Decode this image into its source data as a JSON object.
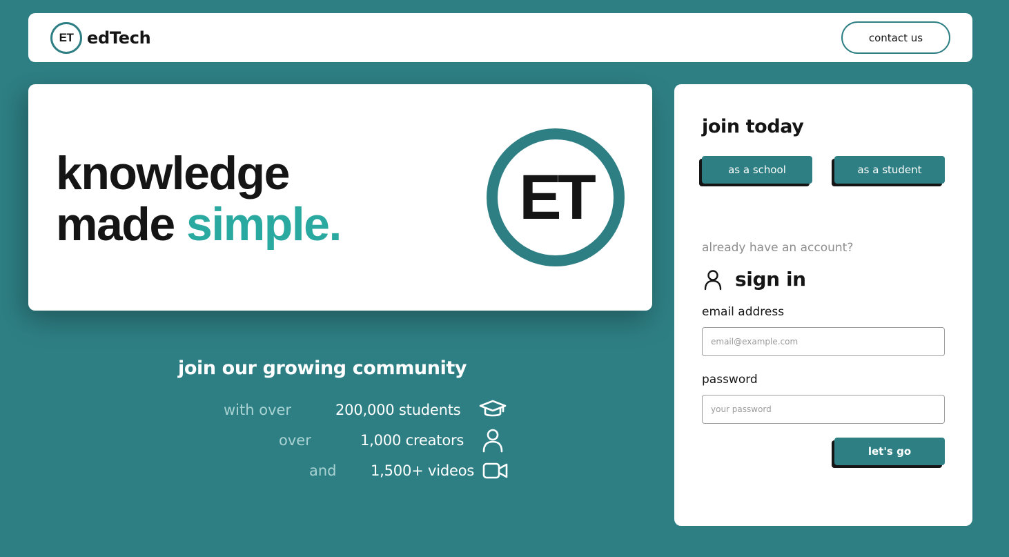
{
  "colors": {
    "brand": "#2e7f84",
    "accent": "#2aa9a0",
    "text": "#151515",
    "muted": "#8d8d8d",
    "white": "#ffffff"
  },
  "header": {
    "logo_text": "ET",
    "brand_name": "edTech",
    "contact_label": "contact us"
  },
  "hero": {
    "line1": "knowledge",
    "line2_plain": "made",
    "line2_accent": "simple.",
    "logo_text": "ET"
  },
  "community": {
    "title": "join our growing community",
    "stats": [
      {
        "lead": "with over",
        "value": "200,000 students",
        "icon": "graduation-cap-icon"
      },
      {
        "lead": "over",
        "value": "1,000 creators",
        "icon": "person-icon"
      },
      {
        "lead": "and",
        "value": "1,500+ videos",
        "icon": "video-camera-icon"
      }
    ]
  },
  "signup": {
    "join_title": "join today",
    "school_button": "as a school",
    "student_button": "as a student",
    "account_question": "already have an account?",
    "signin_title": "sign in",
    "signin_icon": "user-icon",
    "email_label": "email address",
    "email_placeholder": "email@example.com",
    "password_label": "password",
    "password_placeholder": "your password",
    "submit_label": "let's go"
  }
}
